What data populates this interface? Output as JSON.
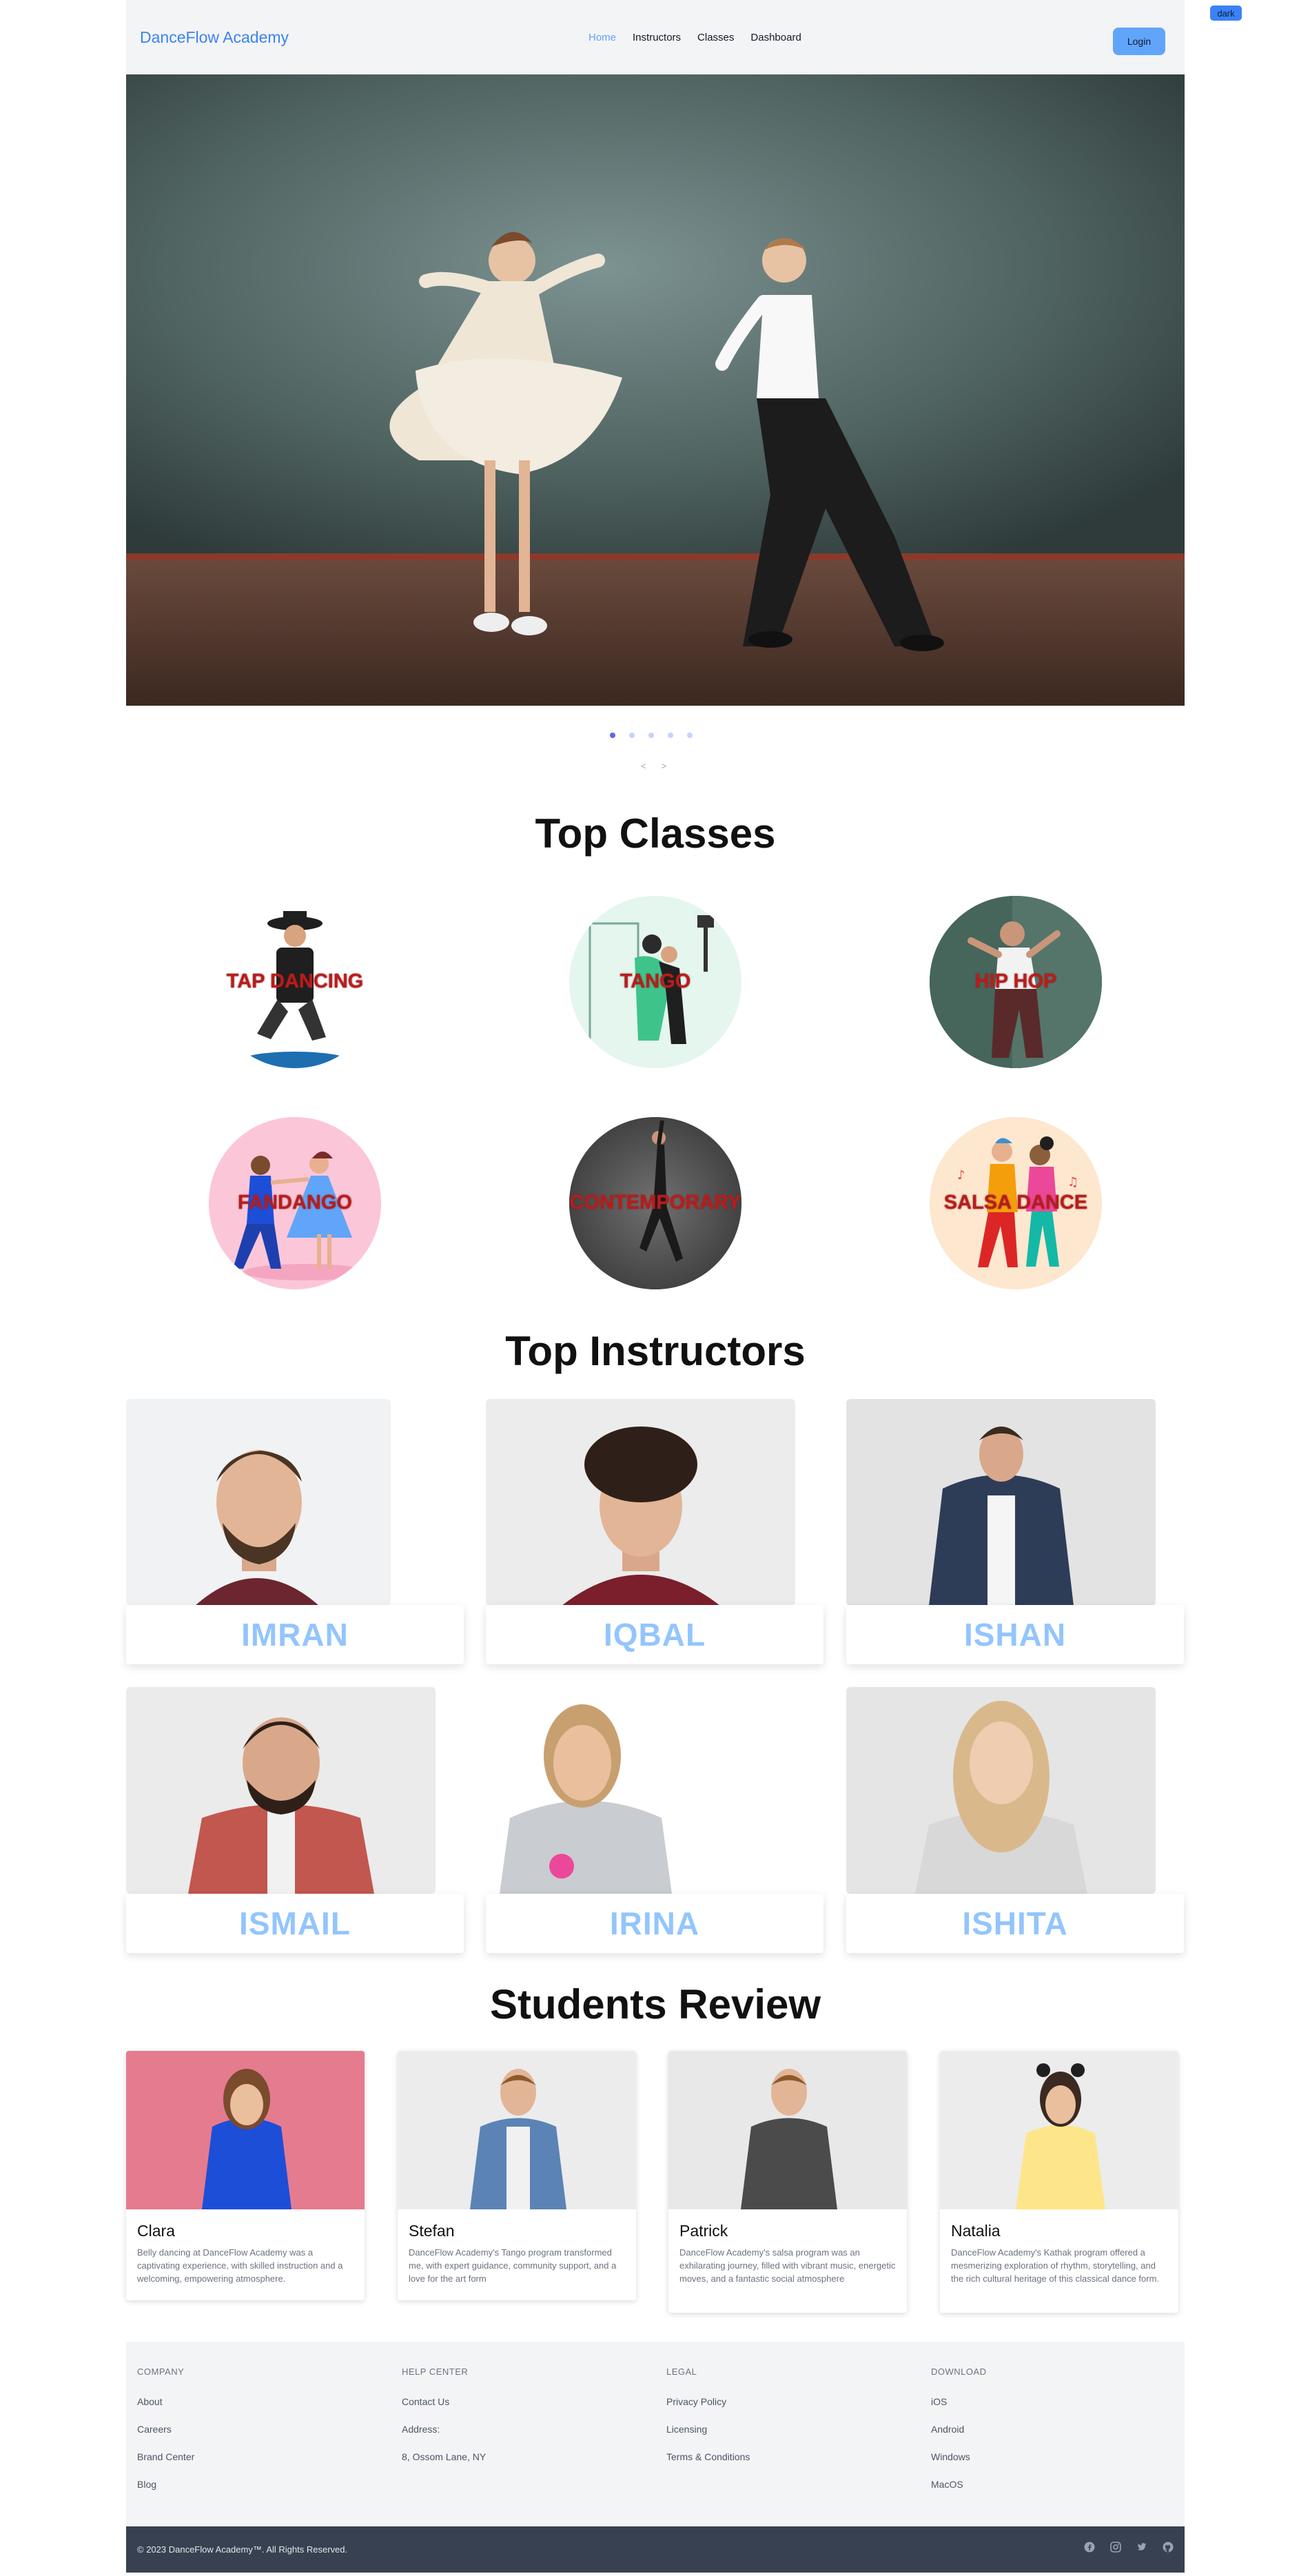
{
  "theme_toggle": "dark",
  "nav": {
    "brand": "DanceFlow Academy",
    "links": [
      "Home",
      "Instructors",
      "Classes",
      "Dashboard"
    ],
    "active": "Home",
    "login": "Login"
  },
  "carousel": {
    "slides": 5,
    "active_slide": 1,
    "prev": "<",
    "next": ">"
  },
  "classes": {
    "title": "Top Classes",
    "items": [
      "TAP DANCING",
      "TANGO",
      "HIP HOP",
      "FANDANGO",
      "CONTEMPORARY",
      "SALSA DANCE"
    ]
  },
  "instructors": {
    "title": "Top Instructors",
    "items": [
      "IMRAN",
      "IQBAL",
      "ISHAN",
      "ISMAIL",
      "IRINA",
      "ISHITA"
    ]
  },
  "reviews": {
    "title": "Students Review",
    "items": [
      {
        "name": "Clara",
        "text": "Belly dancing at DanceFlow Academy was a captivating experience, with skilled instruction and a welcoming, empowering atmosphere."
      },
      {
        "name": "Stefan",
        "text": "DanceFlow Academy's Tango program transformed me, with expert guidance, community support, and a love for the art form"
      },
      {
        "name": "Patrick",
        "text": "DanceFlow Academy's salsa program was an exhilarating journey, filled with vibrant music, energetic moves, and a fantastic social atmosphere"
      },
      {
        "name": "Natalia",
        "text": "DanceFlow Academy's Kathak program offered a mesmerizing exploration of rhythm, storytelling, and the rich cultural heritage of this classical dance form."
      }
    ]
  },
  "footer": {
    "columns": [
      {
        "heading": "COMPANY",
        "links": [
          "About",
          "Careers",
          "Brand Center",
          "Blog"
        ]
      },
      {
        "heading": "HELP CENTER",
        "links": [
          "Contact Us",
          "Address:",
          "8, Ossom Lane, NY"
        ]
      },
      {
        "heading": "LEGAL",
        "links": [
          "Privacy Policy",
          "Licensing",
          "Terms & Conditions"
        ]
      },
      {
        "heading": "DOWNLOAD",
        "links": [
          "iOS",
          "Android",
          "Windows",
          "MacOS"
        ]
      }
    ],
    "copyright": "© 2023 DanceFlow Academy™. All Rights Reserved.",
    "socials": [
      "facebook-icon",
      "instagram-icon",
      "twitter-icon",
      "github-icon"
    ]
  }
}
